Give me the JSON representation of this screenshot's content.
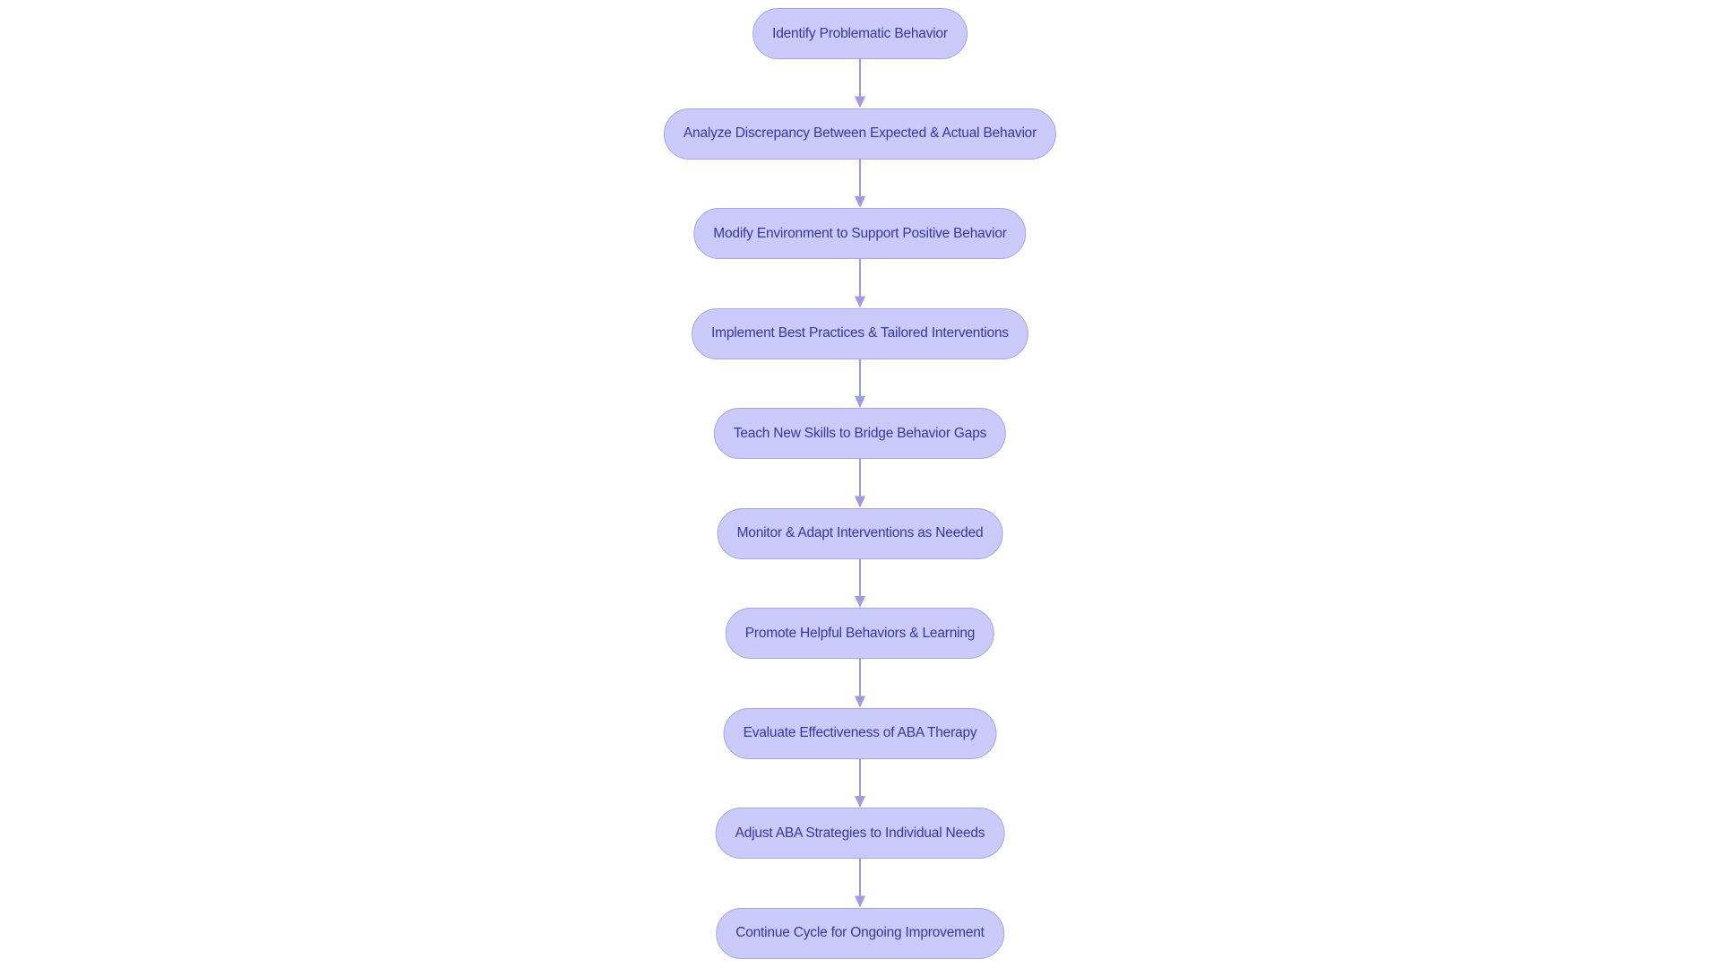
{
  "diagram": {
    "type": "flowchart",
    "direction": "top-down",
    "colors": {
      "node_fill": "#cbcbfb",
      "node_border": "#a4a4e6",
      "node_text": "#3535a8",
      "edge": "#9b9be8"
    },
    "nodes": [
      {
        "id": "n1",
        "label": "Identify Problematic Behavior"
      },
      {
        "id": "n2",
        "label": "Analyze Discrepancy Between Expected & Actual Behavior"
      },
      {
        "id": "n3",
        "label": "Modify Environment to Support Positive Behavior"
      },
      {
        "id": "n4",
        "label": "Implement Best Practices & Tailored Interventions"
      },
      {
        "id": "n5",
        "label": "Teach New Skills to Bridge Behavior Gaps"
      },
      {
        "id": "n6",
        "label": "Monitor & Adapt Interventions as Needed"
      },
      {
        "id": "n7",
        "label": "Promote Helpful Behaviors & Learning"
      },
      {
        "id": "n8",
        "label": "Evaluate Effectiveness of ABA Therapy"
      },
      {
        "id": "n9",
        "label": "Adjust ABA Strategies to Individual Needs"
      },
      {
        "id": "n10",
        "label": "Continue Cycle for Ongoing Improvement"
      }
    ],
    "edges": [
      {
        "from": "n1",
        "to": "n2"
      },
      {
        "from": "n2",
        "to": "n3"
      },
      {
        "from": "n3",
        "to": "n4"
      },
      {
        "from": "n4",
        "to": "n5"
      },
      {
        "from": "n5",
        "to": "n6"
      },
      {
        "from": "n6",
        "to": "n7"
      },
      {
        "from": "n7",
        "to": "n8"
      },
      {
        "from": "n8",
        "to": "n9"
      },
      {
        "from": "n9",
        "to": "n10"
      }
    ]
  }
}
